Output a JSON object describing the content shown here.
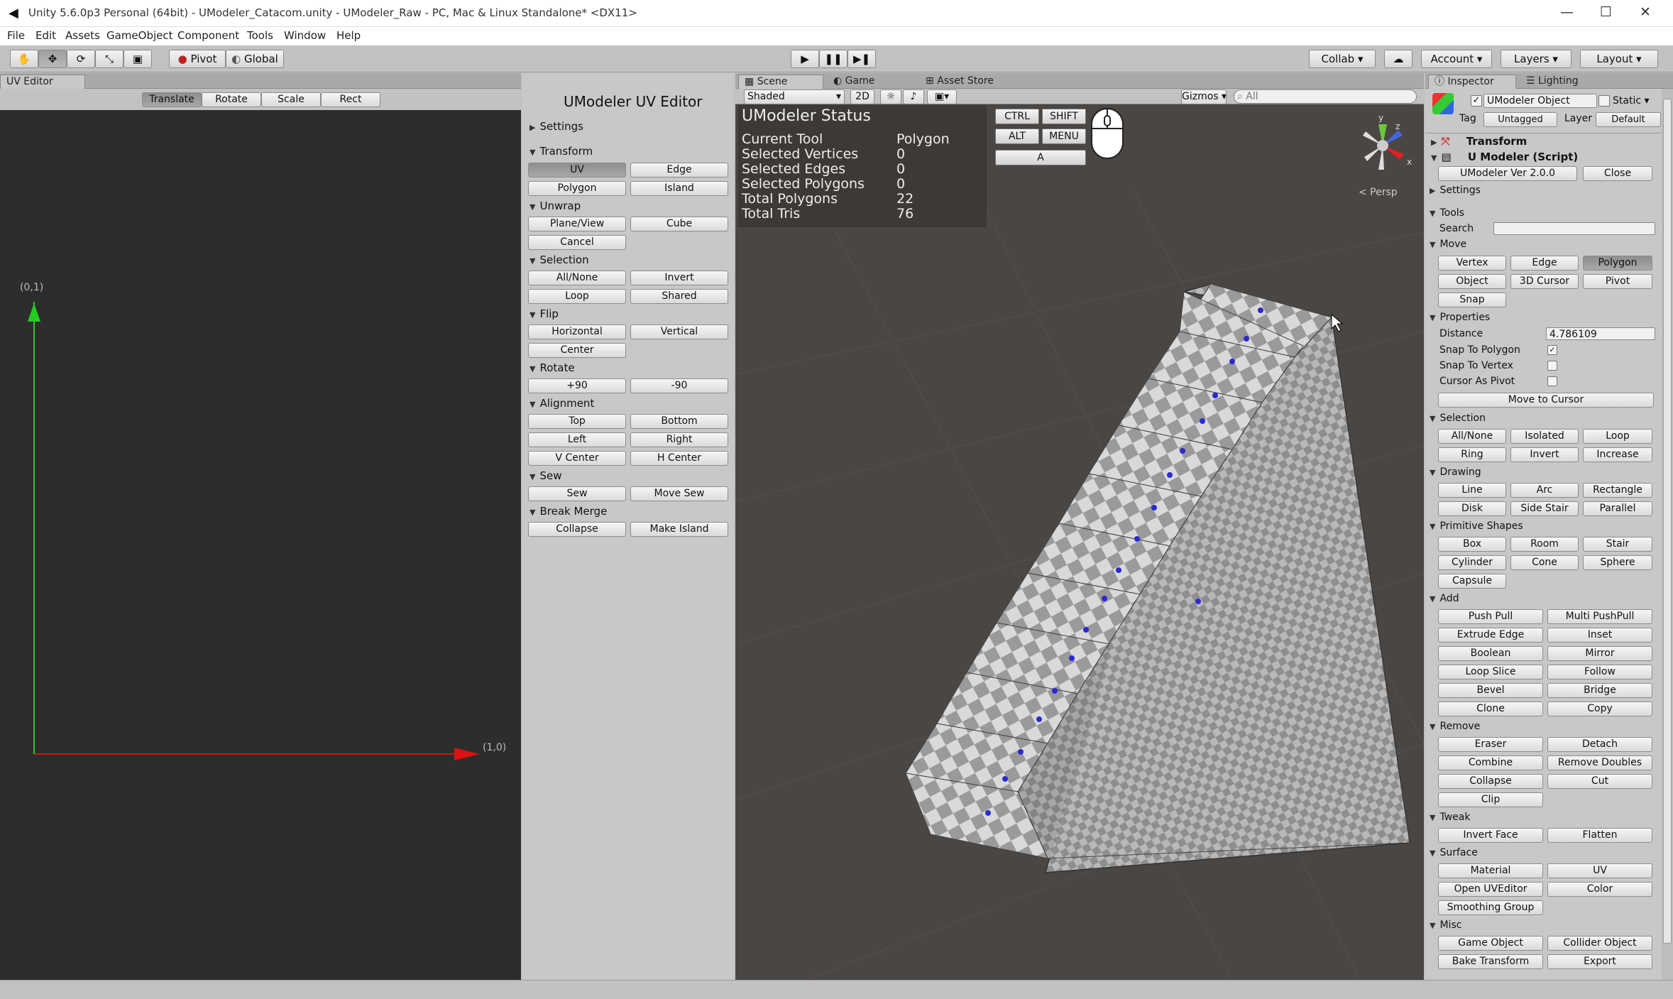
{
  "window": {
    "title": "Unity 5.6.0p3 Personal (64bit) - UModeler_Catacom.unity - UModeler_Raw - PC, Mac & Linux Standalone* <DX11>",
    "controls": [
      "—",
      "☐",
      "✕"
    ]
  },
  "menu": [
    "File",
    "Edit",
    "Assets",
    "GameObject",
    "Component",
    "Tools",
    "Window",
    "Help"
  ],
  "toolbar": {
    "pivot": "Pivot",
    "global": "Global",
    "collab": "Collab ▾",
    "account": "Account ▾",
    "layers": "Layers ▾",
    "layout": "Layout ▾"
  },
  "uv_editor": {
    "tab": "UV Editor",
    "modes": [
      "Translate",
      "Rotate",
      "Scale",
      "Rect"
    ],
    "axis_y": "(0,1)",
    "axis_x": "(1,0)"
  },
  "uv_panel": {
    "title": "UModeler UV Editor",
    "settings": "Settings",
    "transform": "Transform",
    "uv": "UV",
    "edge": "Edge",
    "polygon": "Polygon",
    "island": "Island",
    "unwrap": "Unwrap",
    "plane_view": "Plane/View",
    "cube": "Cube",
    "cancel": "Cancel",
    "selection": "Selection",
    "all_none": "All/None",
    "invert": "Invert",
    "loop": "Loop",
    "shared": "Shared",
    "flip": "Flip",
    "horizontal": "Horizontal",
    "vertical": "Vertical",
    "center": "Center",
    "rotate": "Rotate",
    "plus90": "+90",
    "minus90": "-90",
    "alignment": "Alignment",
    "top": "Top",
    "bottom": "Bottom",
    "left": "Left",
    "right": "Right",
    "vcenter": "V Center",
    "hcenter": "H Center",
    "sew": "Sew",
    "sew_btn": "Sew",
    "move_sew": "Move Sew",
    "break_merge": "Break Merge",
    "collapse": "Collapse",
    "make_island": "Make Island"
  },
  "scene": {
    "tabs": [
      "Scene",
      "Game",
      "Asset Store"
    ],
    "shaded": "Shaded",
    "two_d": "2D",
    "gizmos": "Gizmos ▾",
    "search_placeholder": "All",
    "persp": "< Persp",
    "gizmo_y": "y",
    "gizmo_z": "z",
    "gizmo_x": "x",
    "status": {
      "title": "UModeler Status",
      "rows": [
        {
          "label": "Current Tool",
          "value": "Polygon"
        },
        {
          "label": "Selected Vertices",
          "value": "0"
        },
        {
          "label": "Selected Edges",
          "value": "0"
        },
        {
          "label": "Selected Polygons",
          "value": "0"
        },
        {
          "label": "Total Polygons",
          "value": "22"
        },
        {
          "label": "Total Tris",
          "value": "76"
        }
      ]
    },
    "keys": {
      "ctrl": "CTRL",
      "shift": "SHIFT",
      "alt": "ALT",
      "menu": "MENU",
      "a": "A"
    }
  },
  "inspector": {
    "tabs": [
      "Inspector",
      "Lighting"
    ],
    "object_name": "UModeler Object",
    "static": "Static ▾",
    "tag_label": "Tag",
    "tag_value": "Untagged",
    "layer_label": "Layer",
    "layer_value": "Default",
    "transform": "Transform",
    "script": "U Modeler (Script)",
    "version": "UModeler Ver 2.0.0",
    "close": "Close",
    "settings": "Settings",
    "tools": "Tools",
    "search": "Search",
    "move": "Move",
    "move_btns": [
      "Vertex",
      "Edge",
      "Polygon",
      "Object",
      "3D Cursor",
      "Pivot",
      "Snap"
    ],
    "properties": "Properties",
    "distance_label": "Distance",
    "distance_value": "4.786109",
    "snap_to_polygon": "Snap To Polygon",
    "snap_to_vertex": "Snap To Vertex",
    "cursor_as_pivot": "Cursor As Pivot",
    "move_to_cursor": "Move to Cursor",
    "selection": "Selection",
    "selection_btns": [
      "All/None",
      "Isolated",
      "Loop",
      "Ring",
      "Invert",
      "Increase"
    ],
    "drawing": "Drawing",
    "drawing_btns": [
      "Line",
      "Arc",
      "Rectangle",
      "Disk",
      "Side Stair",
      "Parallel"
    ],
    "primitive": "Primitive Shapes",
    "primitive_btns": [
      "Box",
      "Room",
      "Stair",
      "Cylinder",
      "Cone",
      "Sphere",
      "Capsule"
    ],
    "add": "Add",
    "add_btns": [
      "Push Pull",
      "Multi PushPull",
      "Extrude Edge",
      "Inset",
      "Boolean",
      "Mirror",
      "Loop Slice",
      "Follow",
      "Bevel",
      "Bridge",
      "Clone",
      "Copy"
    ],
    "remove": "Remove",
    "remove_btns": [
      "Eraser",
      "Detach",
      "Combine",
      "Remove Doubles",
      "Collapse",
      "Cut",
      "Clip"
    ],
    "tweak": "Tweak",
    "tweak_btns": [
      "Invert Face",
      "Flatten"
    ],
    "surface": "Surface",
    "surface_btns": [
      "Material",
      "UV",
      "Open UVEditor",
      "Color",
      "Smoothing Group"
    ],
    "misc": "Misc",
    "misc_btns": [
      "Game Object",
      "Collider Object",
      "Bake Transform",
      "Export"
    ]
  }
}
